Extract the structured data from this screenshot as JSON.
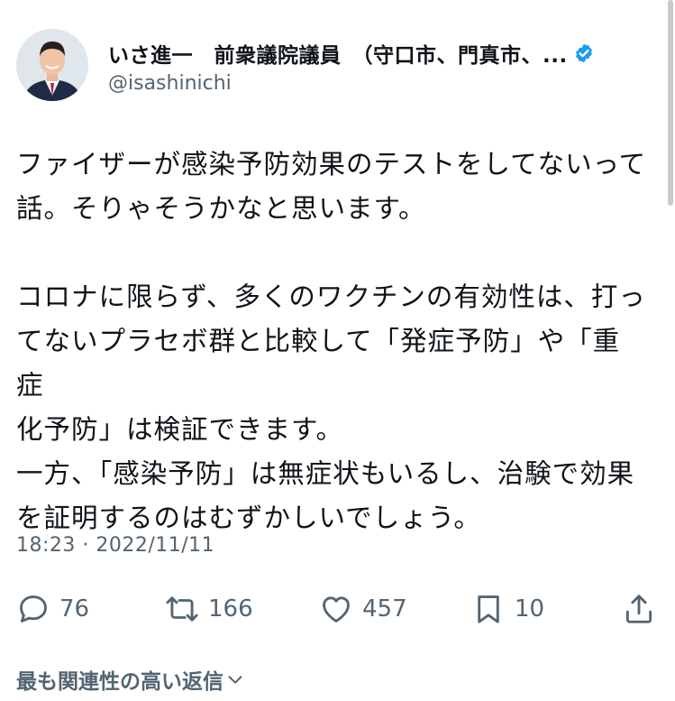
{
  "author": {
    "display_name": "いさ進一　前衆議院議員　（守口市、門真市、...",
    "handle": "@isashinichi",
    "verified": true
  },
  "tweet": {
    "paragraphs": [
      [
        "ファイザーが感染予防効果のテストをしてないって",
        "話。そりゃそうかなと思います。"
      ],
      [
        "コロナに限らず、多くのワクチンの有効性は、打っ",
        "てないプラセボ群と比較して「発症予防」や「重症",
        "化予防」は検証できます。",
        "一方、「感染予防」は無症状もいるし、治験で効果",
        "を証明するのはむずかしいでしょう。"
      ]
    ],
    "timestamp": "18:23 · 2022/11/11"
  },
  "actions": {
    "replies": "76",
    "retweets": "166",
    "likes": "457",
    "bookmarks": "10"
  },
  "replies_sort": {
    "label": "最も関連性の高い返信"
  },
  "colors": {
    "text_primary": "#0f1419",
    "text_secondary": "#536471",
    "verified_blue": "#1d9bf0"
  },
  "icons": [
    "reply-icon",
    "retweet-icon",
    "like-icon",
    "bookmark-icon",
    "share-icon",
    "verified-icon",
    "chevron-down-icon"
  ]
}
